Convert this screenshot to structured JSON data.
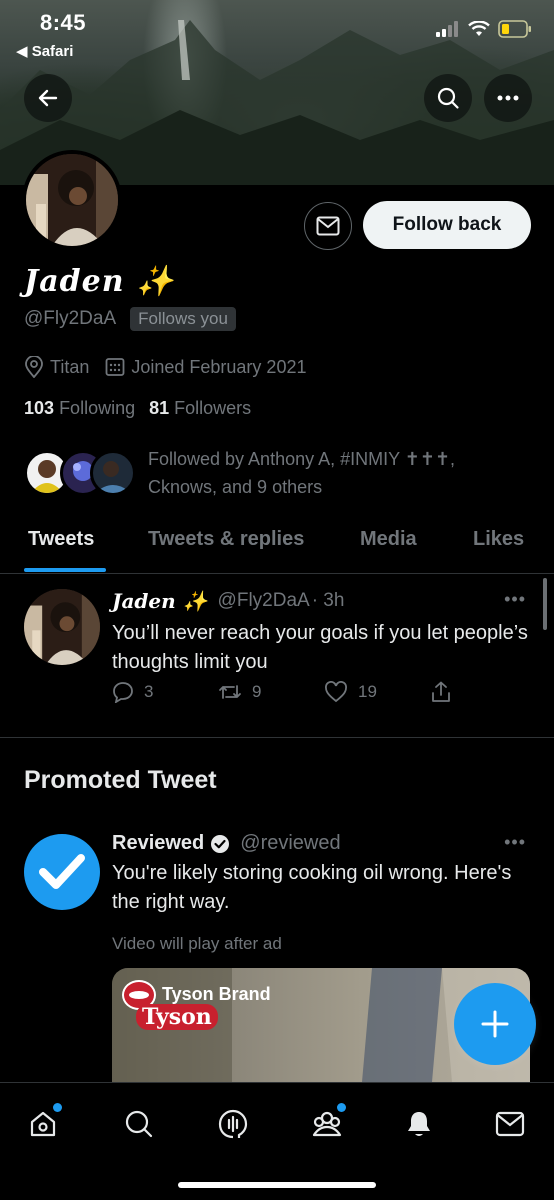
{
  "status_bar": {
    "time": "8:45",
    "back_app": "◀ Safari"
  },
  "header": {
    "back_icon": "arrow-left-icon",
    "search_icon": "search-icon",
    "more_icon": "more-icon"
  },
  "profile": {
    "display_name": "Jaden ✨",
    "handle": "@Fly2DaA",
    "follows_you_badge": "Follows you",
    "follow_back_label": "Follow back",
    "location": "Titan",
    "joined": "Joined February 2021",
    "following_count": "103",
    "following_label": "Following",
    "followers_count": "81",
    "followers_label": "Followers",
    "followed_by_text": "Followed by Anthony A, #INMIY ✝✝✝, Cknows, and 9 others"
  },
  "tabs": [
    {
      "label": "Tweets",
      "active": true
    },
    {
      "label": "Tweets & replies",
      "active": false
    },
    {
      "label": "Media",
      "active": false
    },
    {
      "label": "Likes",
      "active": false
    }
  ],
  "tweet": {
    "name": "Jaden ✨",
    "handle": "@Fly2DaA",
    "time": "· 3h",
    "text": "You’ll never reach your goals if you let people’s thoughts limit you",
    "replies": "3",
    "retweets": "9",
    "likes": "19"
  },
  "promoted": {
    "section_title": "Promoted Tweet",
    "name": "Reviewed",
    "handle": "@reviewed",
    "text": "You're likely storing cooking oil wrong. Here's the right way.",
    "video_note": "Video will play after ad",
    "video_brand": "Tyson Brand",
    "video_logo_text": "Tyson"
  },
  "colors": {
    "accent": "#1d9bf0",
    "background": "#000000",
    "secondary_text": "#71767b"
  },
  "bottom_nav": [
    "home-icon",
    "search-icon",
    "spaces-icon",
    "communities-icon",
    "notifications-icon",
    "messages-icon"
  ]
}
